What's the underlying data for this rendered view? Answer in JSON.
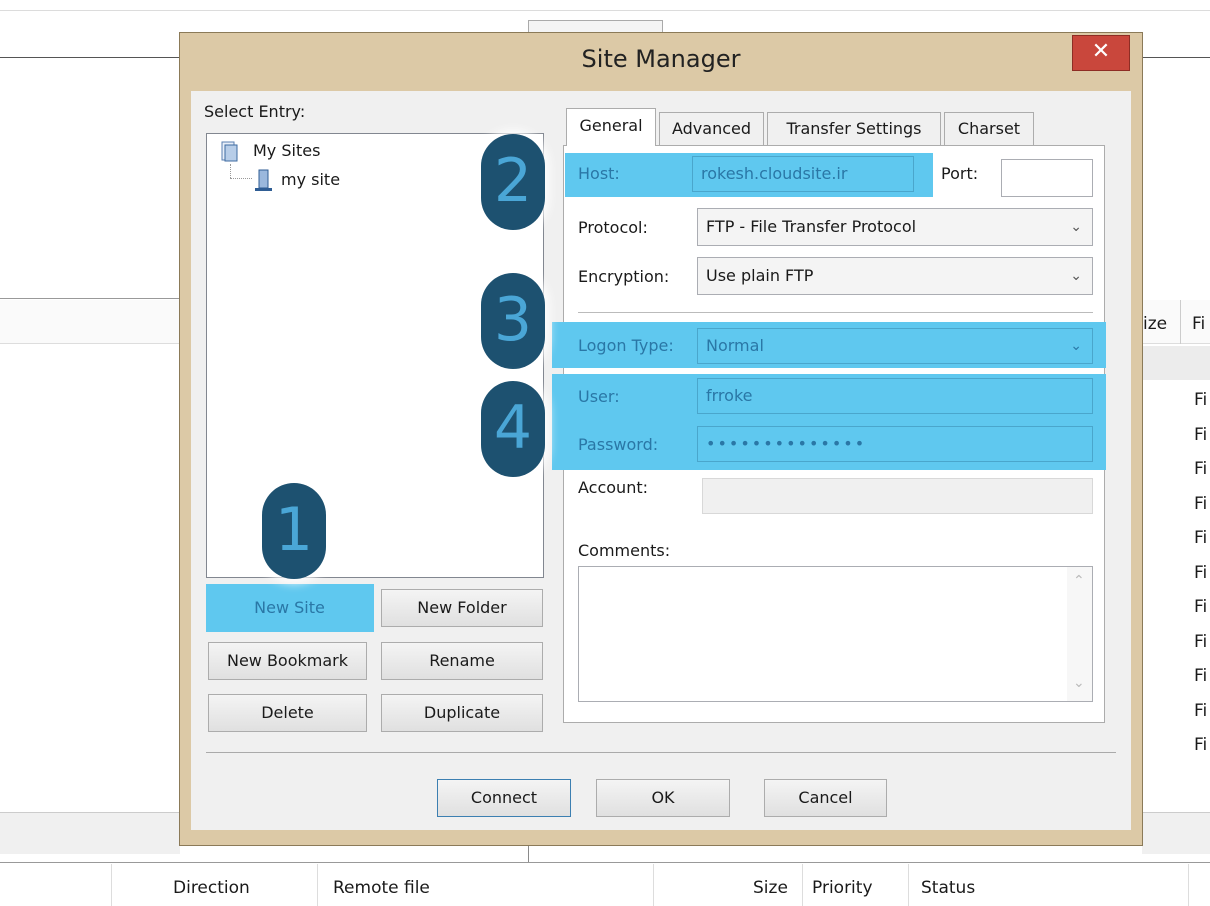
{
  "background": {
    "columns_right": [
      "ize",
      "Fi"
    ],
    "row_prefix": "Fi",
    "row_count": 11,
    "queue_headers": [
      "Direction",
      "Remote file",
      "Size",
      "Priority",
      "Status"
    ]
  },
  "dialog": {
    "title": "Site Manager",
    "close_label": "✕",
    "select_entry_label": "Select Entry:",
    "tree": {
      "root": "My Sites",
      "child": "my site"
    },
    "buttons": {
      "new_site": "New Site",
      "new_folder": "New Folder",
      "new_bookmark": "New Bookmark",
      "rename": "Rename",
      "delete": "Delete",
      "duplicate": "Duplicate",
      "connect": "Connect",
      "ok": "OK",
      "cancel": "Cancel"
    },
    "tabs": [
      "General",
      "Advanced",
      "Transfer Settings",
      "Charset"
    ],
    "active_tab": "General",
    "general": {
      "host_label": "Host:",
      "host_value": "rokesh.cloudsite.ir",
      "port_label": "Port:",
      "port_value": "",
      "protocol_label": "Protocol:",
      "protocol_value": "FTP - File Transfer Protocol",
      "encryption_label": "Encryption:",
      "encryption_value": "Use plain FTP",
      "logon_type_label": "Logon Type:",
      "logon_type_value": "Normal",
      "user_label": "User:",
      "user_value": "frroke",
      "password_label": "Password:",
      "password_value": "••••••••••••••",
      "account_label": "Account:",
      "account_value": "",
      "comments_label": "Comments:",
      "comments_value": ""
    },
    "annotations": [
      "1",
      "2",
      "3",
      "4"
    ]
  },
  "colors": {
    "dialog_frame": "#dcc9a6",
    "highlight": "#5fc8ef",
    "badge": "#1d5170",
    "close": "#c9473c"
  }
}
